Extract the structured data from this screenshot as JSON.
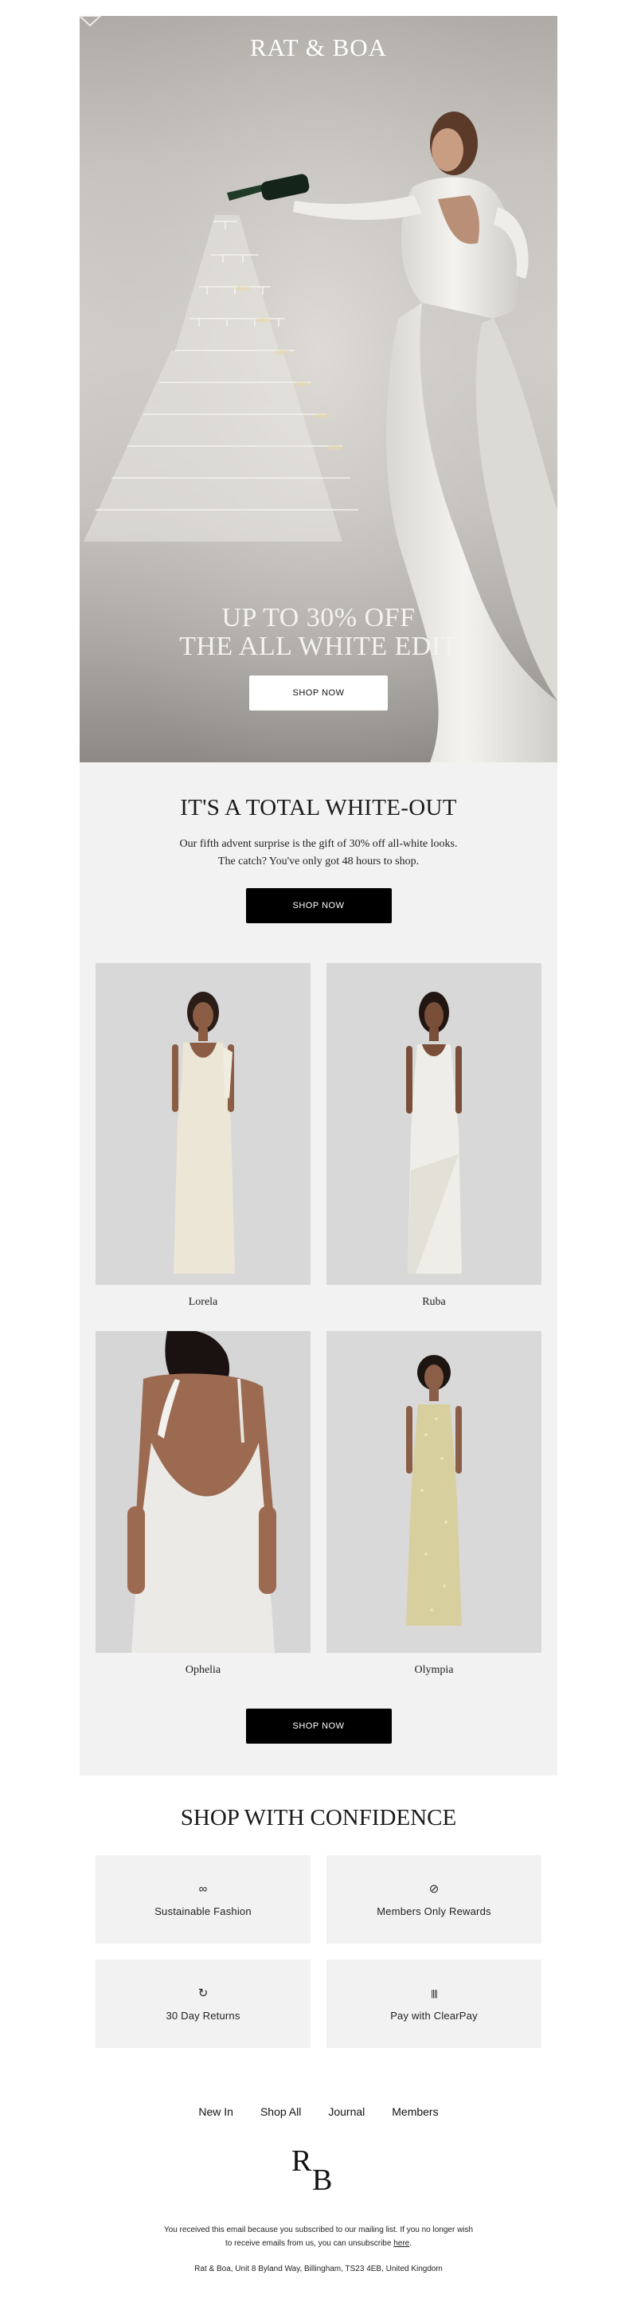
{
  "brand": {
    "logo_text": "RAT & BOA"
  },
  "hero": {
    "headline_line1": "UP TO 30% OFF",
    "headline_line2": "THE ALL WHITE EDIT",
    "cta_label": "SHOP NOW"
  },
  "whiteout": {
    "title": "IT'S A TOTAL WHITE-OUT",
    "body_line1": "Our fifth advent surprise is the gift of 30% off all-white looks.",
    "body_line2": "The catch? You've only got 48 hours to shop.",
    "cta_label": "SHOP NOW"
  },
  "products": [
    {
      "name": "Lorela"
    },
    {
      "name": "Ruba"
    },
    {
      "name": "Ophelia"
    },
    {
      "name": "Olympia"
    }
  ],
  "products_cta_label": "SHOP NOW",
  "confidence": {
    "title": "SHOP WITH CONFIDENCE",
    "items": [
      {
        "icon": "infinity-icon",
        "glyph": "∞",
        "label": "Sustainable Fashion"
      },
      {
        "icon": "compass-icon",
        "glyph": "⊘",
        "label": "Members Only Rewards"
      },
      {
        "icon": "refresh-icon",
        "glyph": "↻",
        "label": "30 Day Returns"
      },
      {
        "icon": "clearpay-icon",
        "glyph": "||||",
        "label": "Pay with ClearPay"
      }
    ]
  },
  "footer": {
    "nav": [
      "New In",
      "Shop All",
      "Journal",
      "Members"
    ],
    "legal_line1": "You received this email because you subscribed to our mailing list. If you no longer wish",
    "legal_line2_prefix": "to receive emails from us, you can unsubscribe",
    "unsubscribe_link": "here",
    "legal_line2_suffix": ".",
    "address": "Rat & Boa, Unit 8 Byland Way, Billingham, TS23 4EB, United Kingdom"
  },
  "colors": {
    "panel_bg": "#f2f2f2",
    "button_black": "#000000",
    "button_white": "#ffffff"
  }
}
